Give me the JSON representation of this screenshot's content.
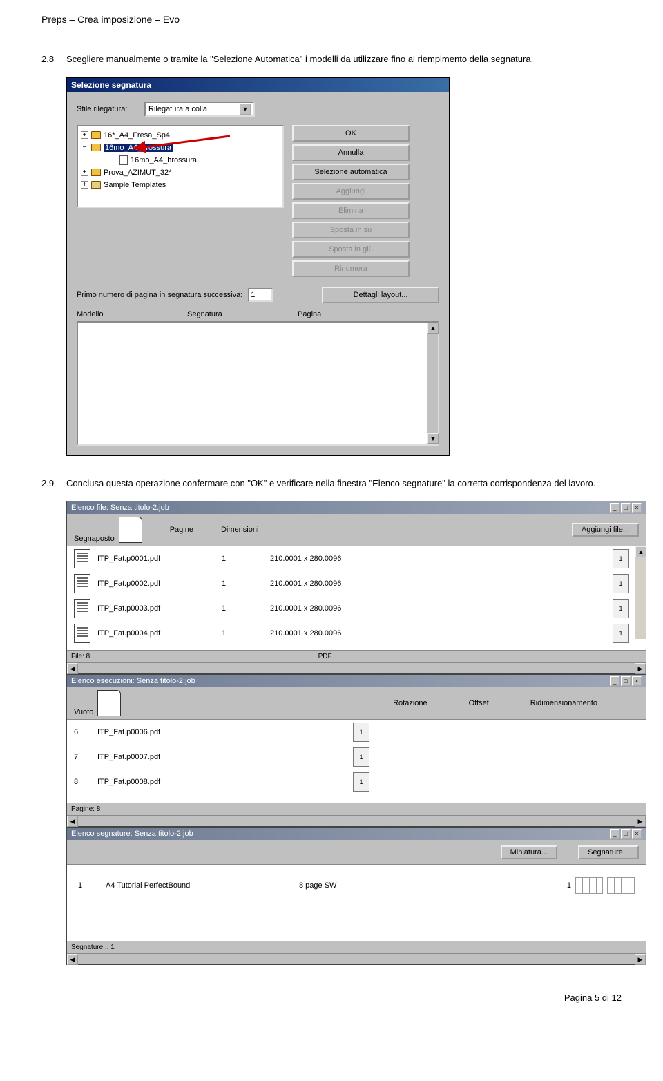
{
  "header": "Preps – Crea imposizione – Evo",
  "step28": {
    "num": "2.8",
    "text": "Scegliere manualmente o tramite la \"Selezione Automatica\" i modelli da utilizzare fino al riempimento della segnatura."
  },
  "dialog": {
    "title": "Selezione segnatura",
    "bindingLabel": "Stile rilegatura:",
    "bindingValue": "Rilegatura a colla",
    "tree": [
      {
        "exp": "+",
        "label": "16*_A4_Fresa_Sp4"
      },
      {
        "exp": "−",
        "label": "16mo_A4_brossura",
        "highlight": true
      },
      {
        "sub": true,
        "label": "16mo_A4_brossura"
      },
      {
        "exp": "+",
        "label": "Prova_AZIMUT_32*"
      },
      {
        "exp": "+",
        "label": "Sample Templates",
        "open": true
      }
    ],
    "buttons": {
      "ok": "OK",
      "cancel": "Annulla",
      "auto": "Selezione automatica",
      "add": "Aggiungi",
      "del": "Elimina",
      "up": "Sposta in su",
      "down": "Sposta in giù",
      "renum": "Rinumera",
      "details": "Dettagli layout..."
    },
    "nextNumLabel": "Primo numero di pagina in segnatura successiva:",
    "nextNumValue": "1",
    "colModel": "Modello",
    "colSig": "Segnatura",
    "colPage": "Pagina"
  },
  "step29": {
    "num": "2.9",
    "text": "Conclusa questa operazione confermare con \"OK\" e verificare nella finestra \"Elenco segnature\" la corretta corrispondenza del lavoro."
  },
  "win1": {
    "title": "Elenco file:  Senza titolo-2.job",
    "placeholderLabel": "Segnaposto",
    "addFiles": "Aggiungi file...",
    "colPages": "Pagine",
    "colDim": "Dimensioni",
    "rows": [
      {
        "name": "ITP_Fat.p0001.pdf",
        "pages": "1",
        "dim": "210.0001 x 280.0096",
        "thumb": "1"
      },
      {
        "name": "ITP_Fat.p0002.pdf",
        "pages": "1",
        "dim": "210.0001 x 280.0096",
        "thumb": "1"
      },
      {
        "name": "ITP_Fat.p0003.pdf",
        "pages": "1",
        "dim": "210.0001 x 280.0096",
        "thumb": "1"
      },
      {
        "name": "ITP_Fat.p0004.pdf",
        "pages": "1",
        "dim": "210.0001 x 280.0096",
        "thumb": "1"
      }
    ],
    "statusLeft": "File: 8",
    "statusRight": "PDF"
  },
  "win2": {
    "title": "Elenco esecuzioni:  Senza titolo-2.job",
    "emptyLabel": "Vuoto",
    "colRot": "Rotazione",
    "colOff": "Offset",
    "colScale": "Ridimensionamento",
    "rows": [
      {
        "n": "6",
        "name": "ITP_Fat.p0006.pdf",
        "thumb": "1"
      },
      {
        "n": "7",
        "name": "ITP_Fat.p0007.pdf",
        "thumb": "1"
      },
      {
        "n": "8",
        "name": "ITP_Fat.p0008.pdf",
        "thumb": "1"
      }
    ],
    "statusLeft": "Pagine: 8"
  },
  "win3": {
    "title": "Elenco segnature:  Senza titolo-2.job",
    "btnMin": "Miniatura...",
    "btnSig": "Segnature...",
    "row": {
      "n": "1",
      "name": "A4 Tutorial PerfectBound",
      "spec": "8 page SW",
      "thumb": "1"
    },
    "statusLeft": "Segnature... 1"
  },
  "footer": "Pagina 5 di 12"
}
